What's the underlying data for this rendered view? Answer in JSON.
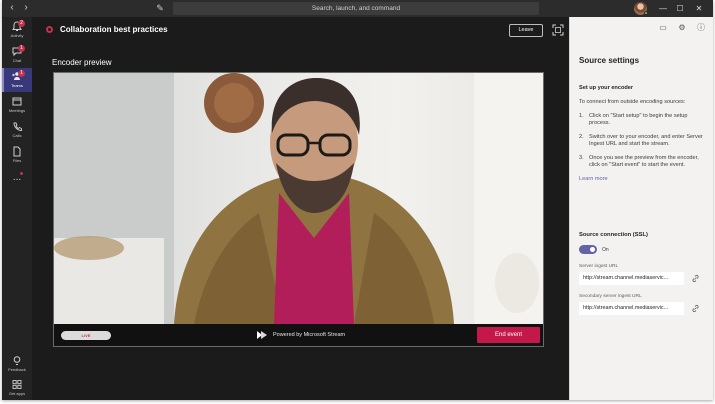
{
  "titlebar": {
    "back_icon": "chevron-left-icon",
    "forward_icon": "chevron-right-icon",
    "compose_icon": "compose-icon",
    "search_text": "Search, launch, and command",
    "window_controls": [
      "—",
      "☐",
      "✕"
    ]
  },
  "rail": {
    "items": [
      {
        "label": "Activity",
        "icon": "bell-icon",
        "badge": "2"
      },
      {
        "label": "Chat",
        "icon": "chat-icon",
        "badge": "1"
      },
      {
        "label": "Teams",
        "icon": "teams-icon",
        "badge": "1"
      },
      {
        "label": "Meetings",
        "icon": "calendar-icon"
      },
      {
        "label": "Calls",
        "icon": "phone-icon"
      },
      {
        "label": "Files",
        "icon": "file-icon"
      },
      {
        "label": "...",
        "icon": "more-icon"
      }
    ],
    "bottom": [
      {
        "label": "Feedback",
        "icon": "lightbulb-icon"
      },
      {
        "label": "Get apps",
        "icon": "apps-icon"
      }
    ]
  },
  "meeting": {
    "title": "Collaboration best practices",
    "leave_label": "Leave"
  },
  "encoder": {
    "label": "Encoder preview",
    "live_label": "LIVE",
    "powered_by": "Powered by Microsoft Stream",
    "end_event_label": "End event"
  },
  "panel": {
    "title": "Source settings",
    "setup_heading": "Set up your encoder",
    "setup_intro": "To connect from outside encoding sources:",
    "steps": [
      {
        "num": "1.",
        "text": "Click on \"Start setup\" to begin the setup process."
      },
      {
        "num": "2.",
        "text": "Switch over to your encoder, and enter Server Ingest URL and start the stream."
      },
      {
        "num": "3.",
        "text": "Once you see the preview from the encoder, click on \"Start event\" to start the event."
      }
    ],
    "learn_more": "Learn more",
    "ssl_heading": "Source connection (SSL)",
    "ssl_state": "On",
    "server_label": "Server ingest URL",
    "server_url": "http://stream.channel.mediaservic...",
    "secondary_label": "Secondary server ingest URL",
    "secondary_url": "http://stream.channel.mediaservic..."
  },
  "colors": {
    "accent": "#6264a7",
    "live_red": "#c4314b",
    "end_event": "#c4184b"
  }
}
